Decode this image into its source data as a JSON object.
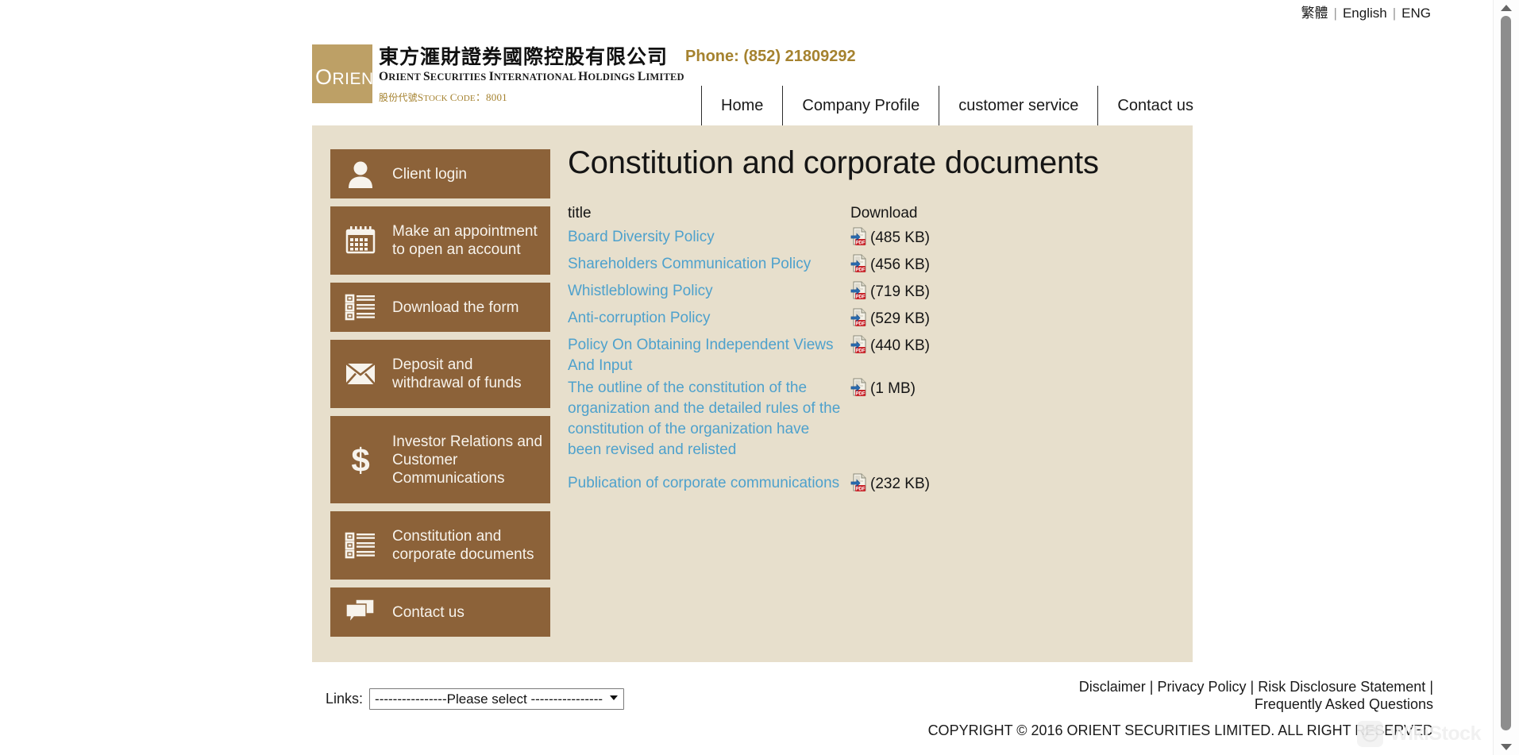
{
  "langbar": {
    "items": [
      {
        "label": "繁體",
        "name": "lang-traditional-chinese"
      },
      {
        "label": "English",
        "name": "lang-english"
      },
      {
        "label": "ENG",
        "name": "lang-eng"
      }
    ],
    "separator": "|"
  },
  "header": {
    "logo_text_o": "O",
    "logo_text_rest": "RIENT",
    "company_cn": "東方滙財證券國際控股有限公司",
    "phone": "Phone: (852) 21809292",
    "company_en_lead": "O",
    "company_en": "RIENT ",
    "company_en_2lead": "S",
    "company_en_2": "ECURITIES ",
    "company_en_3lead": "I",
    "company_en_3": "NTERNATIONAL ",
    "company_en_4lead": "H",
    "company_en_4": "OLDINGS ",
    "company_en_5lead": "L",
    "company_en_5": "IMITED",
    "stock_cn": "股份代號",
    "stock_en": "S",
    "stock_en_rest": "TOCK ",
    "stock_code_lead": "C",
    "stock_code_rest": "ODE",
    "stock_value": "：8001"
  },
  "nav": {
    "items": [
      {
        "label": "Home",
        "name": "nav-home"
      },
      {
        "label": "Company Profile",
        "name": "nav-company-profile"
      },
      {
        "label": "customer service",
        "name": "nav-customer-service"
      },
      {
        "label": "Contact us",
        "name": "nav-contact-us"
      }
    ]
  },
  "sidebar": {
    "items": [
      {
        "label": "Client login",
        "icon": "user-icon",
        "height": "si-h62"
      },
      {
        "label": "Make an appointment to open an account",
        "icon": "calendar-icon",
        "height": "si-h86"
      },
      {
        "label": "Download the form",
        "icon": "list-icon",
        "height": "si-h62"
      },
      {
        "label": "Deposit and withdrawal of funds",
        "icon": "envelope-icon",
        "height": "si-h86"
      },
      {
        "label": "Investor Relations and Customer Communications",
        "icon": "dollar-icon",
        "height": "si-h110"
      },
      {
        "label": "Constitution and corporate documents",
        "icon": "list-icon",
        "height": "si-h86"
      },
      {
        "label": "Contact us",
        "icon": "chat-icon",
        "height": "si-h62"
      }
    ]
  },
  "main": {
    "title": "Constitution and corporate documents",
    "columns": {
      "title": "title",
      "download": "Download"
    },
    "rows": [
      {
        "title": "Board Diversity Policy",
        "size": "(485 KB)"
      },
      {
        "title": "Shareholders Communication Policy",
        "size": "(456 KB)"
      },
      {
        "title": "Whistleblowing Policy",
        "size": "(719 KB)"
      },
      {
        "title": "Anti-corruption Policy",
        "size": "(529 KB)"
      },
      {
        "title": "Policy On Obtaining Independent Views And Input",
        "size": "(440 KB)"
      },
      {
        "title": "The outline of the constitution of the organization and the detailed rules of the constitution of the organization have been revised and relisted",
        "size": "(1 MB)"
      },
      {
        "title": "Publication of corporate communications",
        "size": "(232 KB)"
      }
    ]
  },
  "footer": {
    "links_label": "Links:",
    "select_value": "----------------Please select ----------------",
    "select_options": [
      "----------------Please select ----------------"
    ],
    "links": [
      {
        "label": "Disclaimer",
        "name": "footer-link-disclaimer"
      },
      {
        "label": "Privacy Policy",
        "name": "footer-link-privacy-policy"
      },
      {
        "label": "Risk Disclosure Statement",
        "name": "footer-link-risk-disclosure"
      },
      {
        "label": "Frequently Asked Questions",
        "name": "footer-link-faq"
      }
    ],
    "separator": "|",
    "copyright": "COPYRIGHT © 2016 ORIENT SECURITIES LIMITED. ALL RIGHT RESERVED"
  },
  "watermark": {
    "text": "WikiStock"
  },
  "colors": {
    "brand_brown": "#8c6239",
    "logo_gold": "#bda066",
    "content_bg": "#e7dfcc",
    "link_blue": "#4ea1cc",
    "phone_gold": "#a5822f"
  }
}
